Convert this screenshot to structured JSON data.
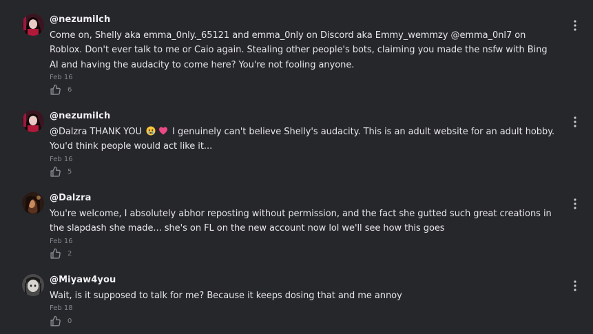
{
  "comments": [
    {
      "username": "@nezumilch",
      "text": "Come on, Shelly aka emma_0nly._65121 and emma_0nly on Discord aka Emmy_wemmzy @emma_0nl7 on Roblox. Don't ever talk to me or Caio again. Stealing other people's bots, claiming you made the nsfw with Bing AI and having the audacity to come here? You're not fooling anyone.",
      "date": "Feb 16",
      "likes": "6"
    },
    {
      "username": "@nezumilch",
      "text_before": "@Dalzra THANK YOU",
      "text_after": "I genuinely can't believe Shelly's audacity. This is an adult website for an adult hobby. You'd think people would act like it...",
      "emojis": [
        "crying-face-emoji",
        "pink-heart-emoji"
      ],
      "date": "Feb 16",
      "likes": "5"
    },
    {
      "username": "@Dalzra",
      "text": "You're welcome, I absolutely abhor reposting without permission, and the fact she gutted such great creations in the slapdash she made... she's on FL on the new account now lol we'll see how this goes",
      "date": "Feb 16",
      "likes": "2"
    },
    {
      "username": "@Miyaw4you",
      "text": "Wait, is it supposed to talk for me? Because it keeps dosing that and me annoy",
      "date": "Feb 18",
      "likes": "0"
    }
  ],
  "icons": {
    "like": "thumbs-up-icon",
    "more": "more-vertical-icon"
  },
  "colors": {
    "background": "#26272b",
    "text": "#e6e6ea",
    "muted": "#85868e"
  }
}
